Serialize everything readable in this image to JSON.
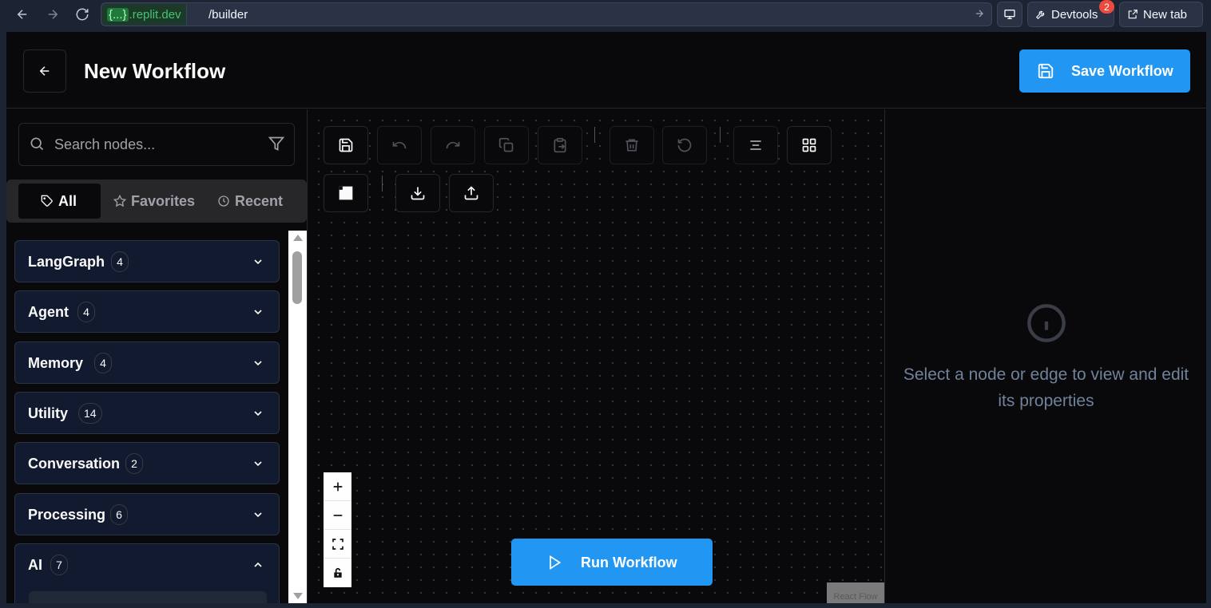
{
  "browser": {
    "url_host_curly": "{...}",
    "url_host": ".replit.dev",
    "url_path": "/builder",
    "devtools_label": "Devtools",
    "devtools_badge": "2",
    "newtab_label": "New tab"
  },
  "header": {
    "title": "New Workflow",
    "save_label": "Save Workflow"
  },
  "sidebar": {
    "search_placeholder": "Search nodes...",
    "tabs": [
      {
        "label": "All",
        "icon": "tag-icon",
        "active": true
      },
      {
        "label": "Favorites",
        "icon": "star-icon",
        "active": false
      },
      {
        "label": "Recent",
        "icon": "clock-icon",
        "active": false
      }
    ],
    "categories": [
      {
        "name": "LangGraph",
        "count": "4",
        "expanded": false
      },
      {
        "name": "Agent",
        "count": "4",
        "expanded": false
      },
      {
        "name": "Memory",
        "count": "4",
        "expanded": false
      },
      {
        "name": "Utility",
        "count": "14",
        "expanded": false
      },
      {
        "name": "Conversation",
        "count": "2",
        "expanded": false
      },
      {
        "name": "Processing",
        "count": "6",
        "expanded": false
      },
      {
        "name": "AI",
        "count": "7",
        "expanded": true
      }
    ]
  },
  "canvas": {
    "toolbar_icons": [
      "save-icon",
      "undo-icon",
      "redo-icon",
      "copy-icon",
      "paste-icon",
      "delete-icon",
      "reset-icon",
      "align-icon",
      "grid-icon",
      "minimap-icon",
      "download-icon",
      "upload-icon"
    ],
    "zoom_controls": [
      "zoom-in-icon",
      "zoom-out-icon",
      "fit-view-icon",
      "lock-icon"
    ],
    "run_label": "Run Workflow",
    "attribution": "React Flow"
  },
  "properties": {
    "empty_message": "Select a node or edge to view and edit its properties"
  },
  "colors": {
    "accent": "#2196f3",
    "background": "#09090b",
    "category_bg": "#111a2e"
  }
}
